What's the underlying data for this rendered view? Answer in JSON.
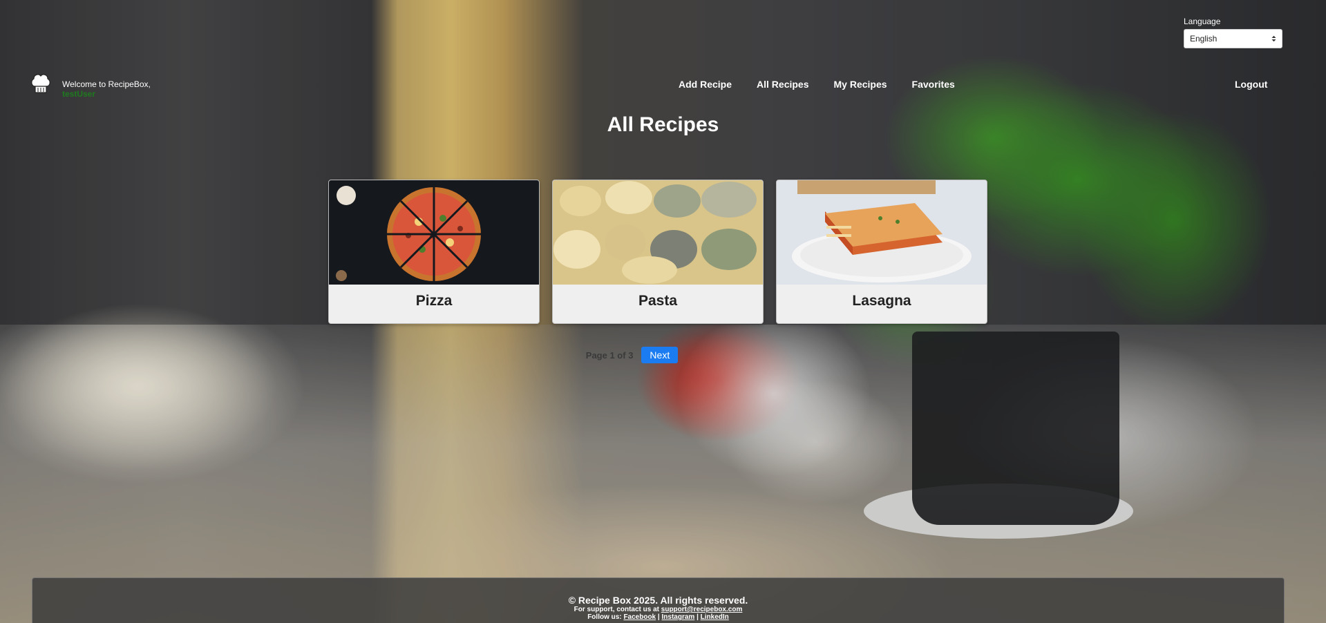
{
  "language": {
    "label": "Language",
    "selected": "English"
  },
  "header": {
    "welcome": "Welcome to RecipeBox,",
    "username": "testUser",
    "nav": {
      "add_recipe": "Add Recipe",
      "all_recipes": "All Recipes",
      "my_recipes": "My Recipes",
      "favorites": "Favorites"
    },
    "logout": "Logout"
  },
  "main": {
    "title": "All Recipes",
    "recipes": [
      {
        "name": "Pizza"
      },
      {
        "name": "Pasta"
      },
      {
        "name": "Lasagna"
      }
    ],
    "pagination": {
      "info": "Page 1 of 3",
      "next": "Next"
    }
  },
  "footer": {
    "copyright": "© Recipe Box 2025. All rights reserved.",
    "support_prefix": "For support, contact us at",
    "support_email": "support@recipebox.com",
    "follow_prefix": "Follow us:",
    "social": [
      "Facebook",
      "Instagram",
      "LinkedIn"
    ],
    "separator": "|"
  },
  "colors": {
    "accent": "#1a7cf0",
    "username": "#1f7a1f"
  }
}
